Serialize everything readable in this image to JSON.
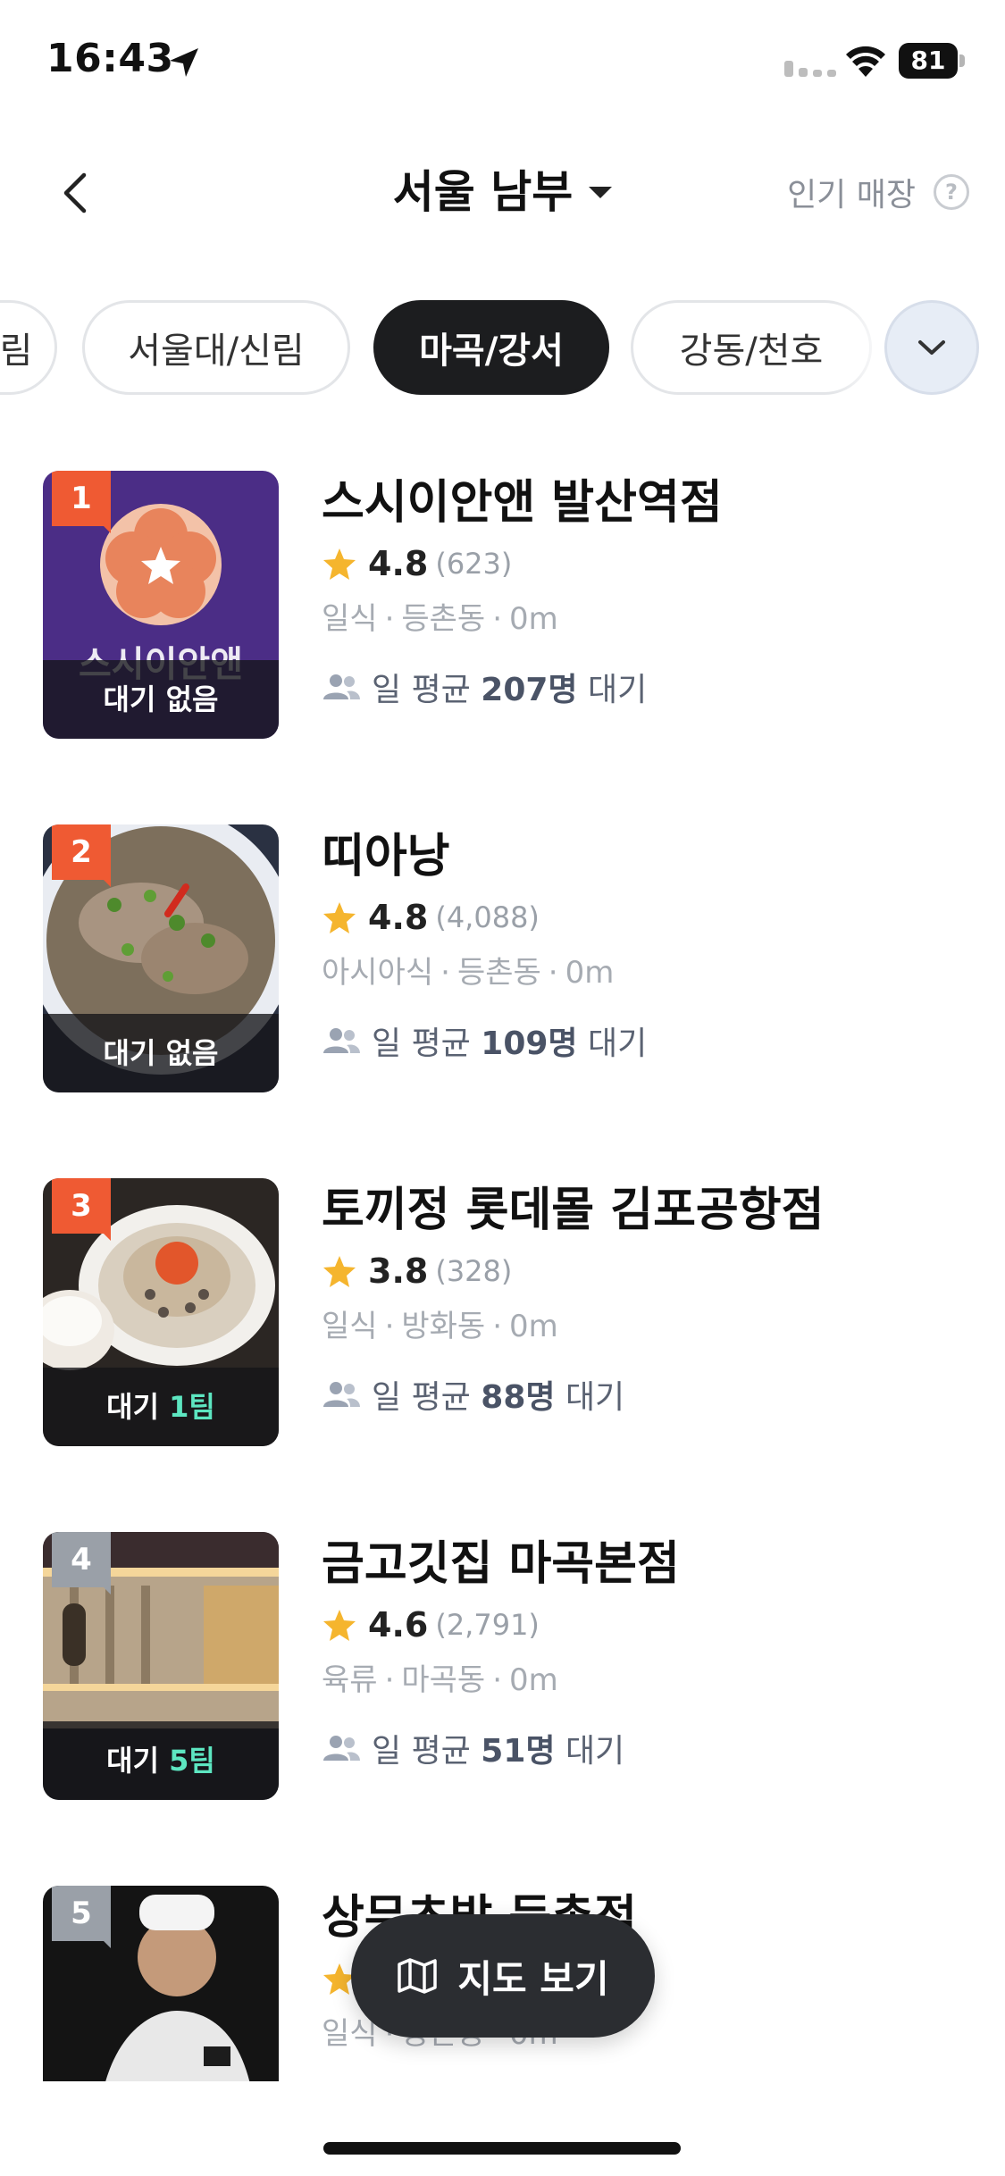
{
  "status": {
    "time": "16:43",
    "battery": "81"
  },
  "header": {
    "title": "서울 남부",
    "popular_label": "인기 매장",
    "help": "?"
  },
  "chips": [
    {
      "label": "림",
      "active": false
    },
    {
      "label": "서울대/신림",
      "active": false
    },
    {
      "label": "마곡/강서",
      "active": true
    },
    {
      "label": "강동/천호",
      "active": false
    }
  ],
  "stores": [
    {
      "rank": "1",
      "name": "스시이안앤 발산역점",
      "rating": "4.8",
      "reviews": "(623)",
      "category": "일식",
      "area": "등촌동",
      "distance": "0m",
      "wait_prefix": "대기 없음",
      "wait_count": "",
      "avg_prefix": "일 평균",
      "avg_count": "207명",
      "avg_suffix": "대기",
      "logo_text": "스시이안앤"
    },
    {
      "rank": "2",
      "name": "띠아낭",
      "rating": "4.8",
      "reviews": "(4,088)",
      "category": "아시아식",
      "area": "등촌동",
      "distance": "0m",
      "wait_prefix": "대기 없음",
      "wait_count": "",
      "avg_prefix": "일 평균",
      "avg_count": "109명",
      "avg_suffix": "대기"
    },
    {
      "rank": "3",
      "name": "토끼정 롯데몰 김포공항점",
      "rating": "3.8",
      "reviews": "(328)",
      "category": "일식",
      "area": "방화동",
      "distance": "0m",
      "wait_prefix": "대기 ",
      "wait_count": "1팀",
      "avg_prefix": "일 평균",
      "avg_count": "88명",
      "avg_suffix": "대기"
    },
    {
      "rank": "4",
      "name": "금고깃집 마곡본점",
      "rating": "4.6",
      "reviews": "(2,791)",
      "category": "육류",
      "area": "마곡동",
      "distance": "0m",
      "wait_prefix": "대기 ",
      "wait_count": "5팀",
      "avg_prefix": "일 평균",
      "avg_count": "51명",
      "avg_suffix": "대기"
    },
    {
      "rank": "5",
      "name": "상무초밥 등촌점",
      "rating": "",
      "reviews": "",
      "category": "일식",
      "area": "등촌동",
      "distance": "0m"
    }
  ],
  "map_button": {
    "label": "지도 보기"
  },
  "colors": {
    "rank_top": "#ef5a33",
    "rank_other": "#9aa0a8",
    "wait_highlight": "#5de6c1",
    "chip_active": "#1c1d1f",
    "star": "#f5b52e"
  }
}
